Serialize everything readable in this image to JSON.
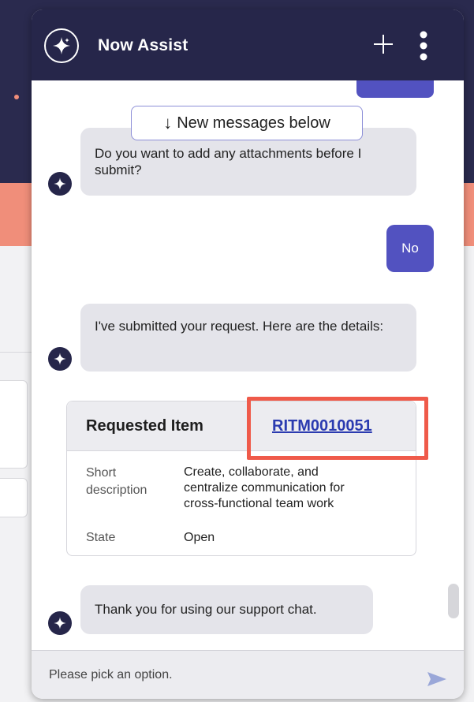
{
  "header": {
    "title": "Now Assist",
    "logo_icon": "sparkle-icon",
    "new_chat_icon": "plus-icon",
    "menu_icon": "kebab-menu-icon"
  },
  "new_messages_banner": {
    "arrow": "↓",
    "label": "New messages below"
  },
  "messages": [
    {
      "sender": "bot",
      "text": "Do you want to add any attachments before I submit?"
    },
    {
      "sender": "user",
      "text": "No"
    },
    {
      "sender": "bot",
      "text": "I've submitted your request. Here are the details:"
    },
    {
      "sender": "bot",
      "text": "Thank you for using our support chat."
    }
  ],
  "request_card": {
    "title": "Requested Item",
    "link": "RITM0010051",
    "fields": [
      {
        "label_line1": "Short",
        "label_line2": "description",
        "value_line1": "Create, collaborate, and",
        "value_line2": "centralize communication for",
        "value_line3": "cross-functional team work"
      },
      {
        "label": "State",
        "value": "Open"
      }
    ]
  },
  "composer": {
    "placeholder": "Please pick an option.",
    "send_icon": "send-icon"
  },
  "colors": {
    "header_bg": "#26264a",
    "user_bubble": "#5252c0",
    "bot_bubble": "#e4e4ea",
    "link": "#2b3bb0",
    "highlight": "#ef5a4a"
  }
}
